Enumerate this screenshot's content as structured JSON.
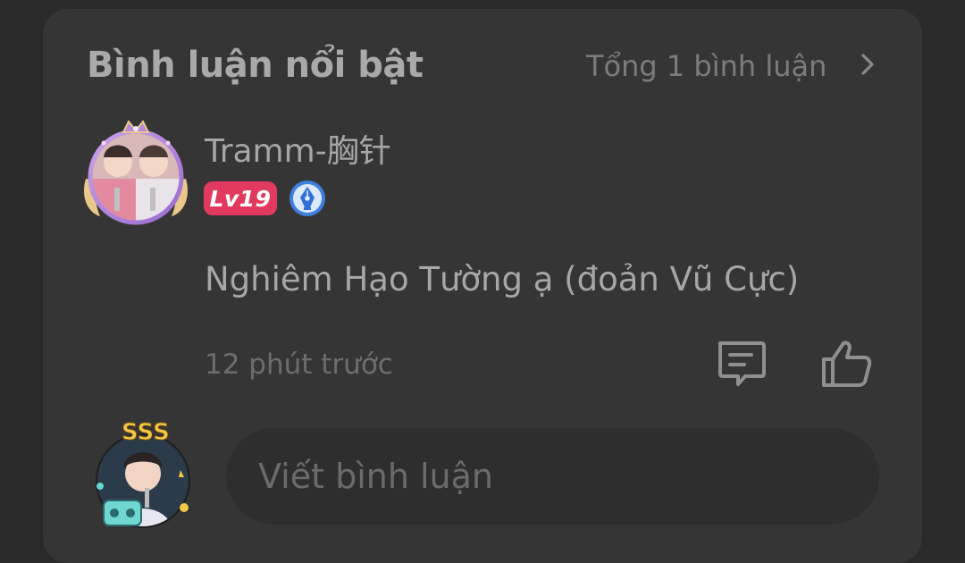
{
  "header": {
    "title": "Bình luận nổi bật",
    "total_label": "Tổng 1 bình luận",
    "arrow_icon": "chevron-right-icon"
  },
  "comment": {
    "username": "Tramm-胸针",
    "level_badge": "Lv19",
    "level_badge_color": "#e23a5e",
    "creator_badge_icon": "pen-nib-badge-icon",
    "text": "Nghiêm Hạo Tường ạ (đoản Vũ Cực)",
    "timestamp": "12 phút trước",
    "reply_icon": "comment-reply-icon",
    "like_icon": "thumbs-up-icon"
  },
  "composer": {
    "placeholder": "Viết bình luận"
  }
}
